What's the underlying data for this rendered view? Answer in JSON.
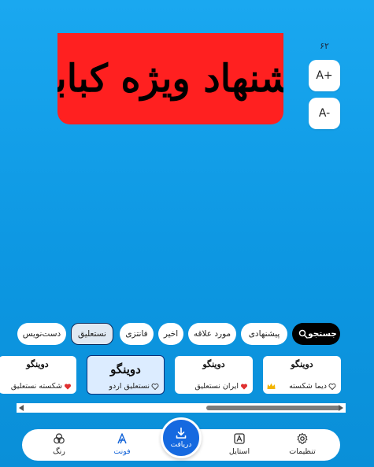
{
  "preview": {
    "banner_text": "پیشنهاد ویژه کبابی",
    "banner_color": "#ff2020",
    "font_size_value": "۶۲",
    "increase_label": "A+",
    "decrease_label": "A-"
  },
  "categories": {
    "search_label": "جستجو",
    "items": [
      {
        "label": "پیشنهادی",
        "active": false
      },
      {
        "label": "مورد علاقه",
        "active": false
      },
      {
        "label": "اخیر",
        "active": false
      },
      {
        "label": "فانتزی",
        "active": false
      },
      {
        "label": "نستعلیق",
        "active": true
      },
      {
        "label": "دست‌نویس",
        "active": false
      }
    ]
  },
  "fonts": [
    {
      "sample": "دوینگو",
      "name": "دیما شکسته",
      "favorite": false,
      "premium": true
    },
    {
      "sample": "دوینگو",
      "name": "ایران نستعلیق",
      "favorite": true,
      "premium": false
    },
    {
      "sample": "دوینگو",
      "name": "نستعلیق اردو",
      "favorite": false,
      "premium": false,
      "selected": true
    },
    {
      "sample": "دوینگو",
      "name": "شکسته نستعلیق",
      "favorite": true,
      "premium": false
    }
  ],
  "scroll_position": 0.62,
  "nav": {
    "settings_label": "تنظیمات",
    "style_label": "استایل",
    "download_label": "دریافت",
    "font_label": "فونت",
    "color_label": "رنگ",
    "active": "font"
  },
  "colors": {
    "accent": "#1569e0",
    "background": "#0d97e2",
    "favorite_heart": "#e03030",
    "crown": "#f2b400"
  }
}
